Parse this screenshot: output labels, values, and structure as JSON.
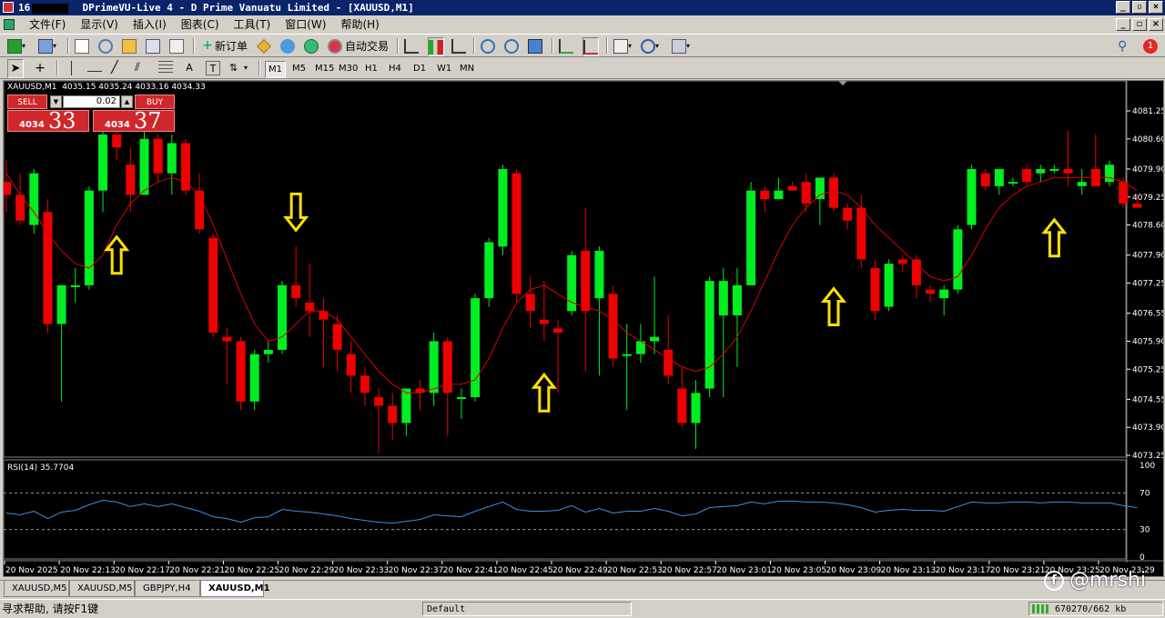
{
  "window": {
    "title_prefix": "16",
    "title": "DPrimeVU-Live 4 - D Prime Vanuatu Limited - [XAUUSD,M1]",
    "controls": [
      "_",
      "▫",
      "×"
    ]
  },
  "menu": [
    "文件(F)",
    "显示(V)",
    "插入(I)",
    "图表(C)",
    "工具(T)",
    "窗口(W)",
    "帮助(H)"
  ],
  "toolbar": {
    "new_order": "新订单",
    "autotrade": "自动交易",
    "notification_count": "1"
  },
  "timeframes": [
    "M1",
    "M5",
    "M15",
    "M30",
    "H1",
    "H4",
    "D1",
    "W1",
    "MN"
  ],
  "active_timeframe": "M1",
  "chart": {
    "symbol_label": "XAUUSD,M1  4035.15 4035.24 4033.16 4034.33",
    "one_click": {
      "sell_label": "SELL",
      "buy_label": "BUY",
      "lot": "0.02",
      "sell_price_prefix": "4034",
      "sell_price_big": "33",
      "buy_price_prefix": "4034",
      "buy_price_big": "37"
    },
    "rsi_label": "RSI(14) 35.7704"
  },
  "chart_data": {
    "type": "candlestick",
    "symbol": "XAUUSD",
    "timeframe": "M1",
    "price_axis": [
      "4081.25",
      "4080.60",
      "4079.90",
      "4079.25",
      "4078.60",
      "4077.90",
      "4077.25",
      "4076.55",
      "4075.90",
      "4075.25",
      "4074.55",
      "4073.90",
      "4073.25"
    ],
    "price_range": [
      4073.25,
      4081.25
    ],
    "time_axis": [
      "20 Nov 2025",
      "20 Nov 22:13",
      "20 Nov 22:17",
      "20 Nov 22:21",
      "20 Nov 22:25",
      "20 Nov 22:29",
      "20 Nov 22:33",
      "20 Nov 22:37",
      "20 Nov 22:41",
      "20 Nov 22:45",
      "20 Nov 22:49",
      "20 Nov 22:53",
      "20 Nov 22:57",
      "20 Nov 23:01",
      "20 Nov 23:05",
      "20 Nov 23:09",
      "20 Nov 23:13",
      "20 Nov 23:17",
      "20 Nov 23:21",
      "20 Nov 23:25",
      "20 Nov 23:29"
    ],
    "rsi_axis": [
      "100",
      "70",
      "30",
      "0"
    ],
    "rsi_levels": [
      70,
      30
    ],
    "colors": {
      "bull": "#00ee22",
      "bear": "#ee0000",
      "ma": "#dd0000",
      "rsi": "#3a8fe0",
      "arrow": "#ffe000"
    },
    "candles": [
      {
        "o": 4079.6,
        "h": 4080.1,
        "l": 4078.9,
        "c": 4079.3
      },
      {
        "o": 4079.3,
        "h": 4079.8,
        "l": 4078.6,
        "c": 4078.7
      },
      {
        "o": 4078.6,
        "h": 4079.9,
        "l": 4078.4,
        "c": 4079.8
      },
      {
        "o": 4078.9,
        "h": 4079.2,
        "l": 4076.1,
        "c": 4076.3
      },
      {
        "o": 4076.3,
        "h": 4077.2,
        "l": 4074.5,
        "c": 4077.2
      },
      {
        "o": 4077.2,
        "h": 4077.6,
        "l": 4076.8,
        "c": 4077.2
      },
      {
        "o": 4077.2,
        "h": 4079.5,
        "l": 4077.1,
        "c": 4079.4
      },
      {
        "o": 4079.4,
        "h": 4080.9,
        "l": 4078.9,
        "c": 4080.7
      },
      {
        "o": 4080.7,
        "h": 4080.9,
        "l": 4080.1,
        "c": 4080.4
      },
      {
        "o": 4080.0,
        "h": 4080.4,
        "l": 4078.9,
        "c": 4079.3
      },
      {
        "o": 4079.3,
        "h": 4080.9,
        "l": 4079.3,
        "c": 4080.6
      },
      {
        "o": 4080.6,
        "h": 4080.7,
        "l": 4079.6,
        "c": 4079.8
      },
      {
        "o": 4079.8,
        "h": 4080.7,
        "l": 4079.3,
        "c": 4080.5
      },
      {
        "o": 4080.5,
        "h": 4080.6,
        "l": 4079.3,
        "c": 4079.4
      },
      {
        "o": 4079.4,
        "h": 4079.8,
        "l": 4078.4,
        "c": 4078.5
      },
      {
        "o": 4078.3,
        "h": 4078.4,
        "l": 4076.0,
        "c": 4076.1
      },
      {
        "o": 4076.0,
        "h": 4076.2,
        "l": 4074.9,
        "c": 4075.9
      },
      {
        "o": 4075.9,
        "h": 4076.0,
        "l": 4074.3,
        "c": 4074.5
      },
      {
        "o": 4074.5,
        "h": 4075.7,
        "l": 4074.3,
        "c": 4075.6
      },
      {
        "o": 4075.6,
        "h": 4075.9,
        "l": 4075.4,
        "c": 4075.7
      },
      {
        "o": 4075.7,
        "h": 4077.3,
        "l": 4075.6,
        "c": 4077.2
      },
      {
        "o": 4077.2,
        "h": 4078.1,
        "l": 4076.7,
        "c": 4076.9
      },
      {
        "o": 4076.8,
        "h": 4077.7,
        "l": 4076.0,
        "c": 4076.6
      },
      {
        "o": 4076.6,
        "h": 4076.9,
        "l": 4075.3,
        "c": 4076.4
      },
      {
        "o": 4076.3,
        "h": 4076.5,
        "l": 4075.2,
        "c": 4075.7
      },
      {
        "o": 4075.6,
        "h": 4075.9,
        "l": 4074.7,
        "c": 4075.1
      },
      {
        "o": 4075.1,
        "h": 4075.3,
        "l": 4074.4,
        "c": 4074.7
      },
      {
        "o": 4074.6,
        "h": 4074.8,
        "l": 4073.3,
        "c": 4074.4
      },
      {
        "o": 4074.4,
        "h": 4074.7,
        "l": 4073.6,
        "c": 4074.0
      },
      {
        "o": 4074.0,
        "h": 4074.6,
        "l": 4073.7,
        "c": 4074.8
      },
      {
        "o": 4074.8,
        "h": 4075.0,
        "l": 4074.3,
        "c": 4074.7
      },
      {
        "o": 4074.7,
        "h": 4076.1,
        "l": 4074.4,
        "c": 4075.9
      },
      {
        "o": 4075.9,
        "h": 4076.0,
        "l": 4073.7,
        "c": 4074.7
      },
      {
        "o": 4074.6,
        "h": 4074.8,
        "l": 4074.1,
        "c": 4074.6
      },
      {
        "o": 4074.6,
        "h": 4077.0,
        "l": 4074.5,
        "c": 4076.9
      },
      {
        "o": 4076.9,
        "h": 4078.3,
        "l": 4076.7,
        "c": 4078.2
      },
      {
        "o": 4078.1,
        "h": 4080.0,
        "l": 4077.9,
        "c": 4079.9
      },
      {
        "o": 4079.8,
        "h": 4079.9,
        "l": 4076.8,
        "c": 4077.0
      },
      {
        "o": 4077.0,
        "h": 4077.4,
        "l": 4076.2,
        "c": 4076.6
      },
      {
        "o": 4076.4,
        "h": 4077.3,
        "l": 4075.9,
        "c": 4076.3
      },
      {
        "o": 4076.2,
        "h": 4076.4,
        "l": 4074.7,
        "c": 4076.1
      },
      {
        "o": 4076.6,
        "h": 4078.0,
        "l": 4076.5,
        "c": 4077.9
      },
      {
        "o": 4078.0,
        "h": 4079.0,
        "l": 4075.2,
        "c": 4076.6
      },
      {
        "o": 4076.9,
        "h": 4078.1,
        "l": 4075.1,
        "c": 4078.0
      },
      {
        "o": 4077.0,
        "h": 4077.2,
        "l": 4075.3,
        "c": 4075.5
      },
      {
        "o": 4075.6,
        "h": 4076.3,
        "l": 4074.3,
        "c": 4075.6
      },
      {
        "o": 4075.6,
        "h": 4076.3,
        "l": 4075.4,
        "c": 4075.9
      },
      {
        "o": 4075.9,
        "h": 4077.4,
        "l": 4075.6,
        "c": 4076.0
      },
      {
        "o": 4075.7,
        "h": 4076.5,
        "l": 4074.9,
        "c": 4075.1
      },
      {
        "o": 4074.8,
        "h": 4075.3,
        "l": 4073.9,
        "c": 4074.0
      },
      {
        "o": 4074.0,
        "h": 4075.0,
        "l": 4073.4,
        "c": 4074.7
      },
      {
        "o": 4074.8,
        "h": 4077.4,
        "l": 4074.6,
        "c": 4077.3
      },
      {
        "o": 4076.5,
        "h": 4077.6,
        "l": 4074.6,
        "c": 4077.3
      },
      {
        "o": 4076.5,
        "h": 4077.6,
        "l": 4075.3,
        "c": 4077.2
      },
      {
        "o": 4077.2,
        "h": 4079.6,
        "l": 4077.2,
        "c": 4079.4
      },
      {
        "o": 4079.4,
        "h": 4079.5,
        "l": 4078.9,
        "c": 4079.2
      },
      {
        "o": 4079.2,
        "h": 4079.7,
        "l": 4079.2,
        "c": 4079.4
      },
      {
        "o": 4079.5,
        "h": 4079.6,
        "l": 4079.4,
        "c": 4079.4
      },
      {
        "o": 4079.6,
        "h": 4079.8,
        "l": 4078.9,
        "c": 4079.1
      },
      {
        "o": 4079.2,
        "h": 4079.7,
        "l": 4078.6,
        "c": 4079.7
      },
      {
        "o": 4079.7,
        "h": 4079.8,
        "l": 4078.9,
        "c": 4079.0
      },
      {
        "o": 4079.0,
        "h": 4079.1,
        "l": 4078.5,
        "c": 4078.7
      },
      {
        "o": 4079.0,
        "h": 4079.3,
        "l": 4077.6,
        "c": 4077.8
      },
      {
        "o": 4077.6,
        "h": 4077.8,
        "l": 4076.4,
        "c": 4076.6
      },
      {
        "o": 4076.7,
        "h": 4077.8,
        "l": 4076.6,
        "c": 4077.7
      },
      {
        "o": 4077.8,
        "h": 4077.9,
        "l": 4077.5,
        "c": 4077.7
      },
      {
        "o": 4077.8,
        "h": 4077.9,
        "l": 4076.9,
        "c": 4077.2
      },
      {
        "o": 4077.1,
        "h": 4077.2,
        "l": 4076.8,
        "c": 4077.0
      },
      {
        "o": 4076.9,
        "h": 4077.2,
        "l": 4076.5,
        "c": 4077.1
      },
      {
        "o": 4077.1,
        "h": 4078.6,
        "l": 4077.0,
        "c": 4078.5
      },
      {
        "o": 4078.6,
        "h": 4080.0,
        "l": 4078.5,
        "c": 4079.9
      },
      {
        "o": 4079.8,
        "h": 4079.9,
        "l": 4079.4,
        "c": 4079.5
      },
      {
        "o": 4079.5,
        "h": 4079.9,
        "l": 4079.3,
        "c": 4079.9
      },
      {
        "o": 4079.6,
        "h": 4079.7,
        "l": 4079.5,
        "c": 4079.6
      },
      {
        "o": 4079.9,
        "h": 4080.0,
        "l": 4079.5,
        "c": 4079.6
      },
      {
        "o": 4079.8,
        "h": 4080.0,
        "l": 4079.6,
        "c": 4079.9
      },
      {
        "o": 4079.9,
        "h": 4080.0,
        "l": 4079.8,
        "c": 4079.9
      },
      {
        "o": 4079.9,
        "h": 4080.8,
        "l": 4079.5,
        "c": 4079.8
      },
      {
        "o": 4079.5,
        "h": 4079.9,
        "l": 4079.3,
        "c": 4079.6
      },
      {
        "o": 4079.9,
        "h": 4080.7,
        "l": 4079.5,
        "c": 4079.5
      },
      {
        "o": 4079.6,
        "h": 4080.1,
        "l": 4079.5,
        "c": 4080.0
      },
      {
        "o": 4079.6,
        "h": 4079.7,
        "l": 4079.0,
        "c": 4079.1
      },
      {
        "o": 4079.1,
        "h": 4079.3,
        "l": 4079.0,
        "c": 4079.0
      }
    ],
    "ma": [
      4079.8,
      4079.3,
      4078.9,
      4078.4,
      4078.0,
      4077.7,
      4077.6,
      4077.9,
      4078.6,
      4079.1,
      4079.4,
      4079.6,
      4079.7,
      4079.6,
      4079.3,
      4078.6,
      4077.8,
      4077.0,
      4076.3,
      4075.9,
      4076.0,
      4076.3,
      4076.6,
      4076.6,
      4076.4,
      4076.0,
      4075.6,
      4075.2,
      4074.9,
      4074.7,
      4074.7,
      4074.8,
      4074.9,
      4074.9,
      4075.0,
      4075.5,
      4076.2,
      4076.8,
      4077.1,
      4077.2,
      4077.0,
      4076.8,
      4076.7,
      4076.6,
      4076.4,
      4076.1,
      4075.9,
      4075.7,
      4075.5,
      4075.3,
      4075.2,
      4075.3,
      4075.6,
      4076.0,
      4076.6,
      4077.3,
      4078.0,
      4078.6,
      4079.0,
      4079.3,
      4079.4,
      4079.3,
      4079.0,
      4078.6,
      4078.3,
      4078.0,
      4077.7,
      4077.4,
      4077.3,
      4077.4,
      4077.9,
      4078.5,
      4079.0,
      4079.3,
      4079.5,
      4079.6,
      4079.7,
      4079.7,
      4079.7,
      4079.7,
      4079.7,
      4079.6,
      4079.4
    ],
    "rsi": [
      48,
      46,
      50,
      42,
      49,
      51,
      57,
      62,
      60,
      55,
      58,
      55,
      58,
      54,
      50,
      44,
      42,
      38,
      43,
      44,
      52,
      50,
      49,
      47,
      45,
      42,
      40,
      38,
      37,
      39,
      41,
      46,
      45,
      44,
      50,
      55,
      60,
      52,
      50,
      50,
      51,
      56,
      49,
      53,
      48,
      50,
      50,
      53,
      50,
      45,
      47,
      54,
      55,
      56,
      60,
      58,
      61,
      61,
      60,
      60,
      59,
      57,
      54,
      49,
      51,
      52,
      51,
      51,
      50,
      55,
      60,
      59,
      59,
      60,
      60,
      59,
      60,
      60,
      59,
      59,
      59,
      56,
      54
    ],
    "arrows": [
      {
        "bar": 8,
        "dir": "up",
        "price": 4077.9
      },
      {
        "bar": 21,
        "dir": "down",
        "price": 4078.9
      },
      {
        "bar": 39,
        "dir": "up",
        "price": 4074.7
      },
      {
        "bar": 60,
        "dir": "up",
        "price": 4076.7
      },
      {
        "bar": 76,
        "dir": "up",
        "price": 4078.3
      }
    ]
  },
  "tabs": [
    "XAUUSD,M5",
    "XAUUSD,M5",
    "GBPJPY,H4",
    "XAUUSD,M1"
  ],
  "active_tab": 3,
  "status": {
    "help": "寻求帮助, 请按F1键",
    "profile": "Default",
    "traffic": "670270/662 kb"
  },
  "watermark": "@mrshi"
}
